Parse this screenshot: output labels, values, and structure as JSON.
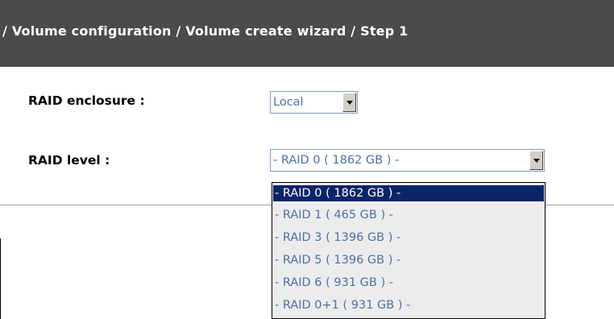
{
  "header": {
    "breadcrumb": "/ Volume configuration / Volume create wizard / Step 1"
  },
  "form": {
    "raid_enclosure": {
      "label": "RAID enclosure :",
      "value": "Local"
    },
    "raid_level": {
      "label": "RAID level :",
      "value": "- RAID 0 ( 1862 GB ) -",
      "options": [
        "- RAID 0 ( 1862 GB ) -",
        "- RAID 1 ( 465 GB ) -",
        "- RAID 3 ( 1396 GB ) -",
        "- RAID 5 ( 1396 GB ) -",
        "- RAID 6 ( 931 GB ) -",
        "- RAID 0+1 ( 931 GB ) -"
      ],
      "highlighted_option": "- RAID 0 ( 1862 GB ) -"
    }
  },
  "icons": {
    "dropdown": "chevron-down-icon"
  },
  "colors": {
    "header_bg": "#4b4b4b",
    "header_text": "#ffffff",
    "select_text": "#4f6fa8",
    "highlight_bg": "#0a246a",
    "highlight_text": "#ffffff",
    "listbox_bg": "#ececec"
  }
}
